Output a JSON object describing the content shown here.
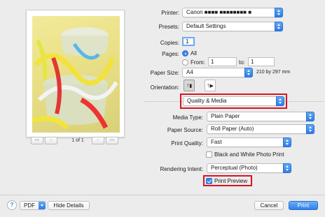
{
  "printer": {
    "label": "Printer:",
    "value": "Canon ■■■■ ■■■■■■■■ ■"
  },
  "presets": {
    "label": "Presets:",
    "value": "Default Settings"
  },
  "copies": {
    "label": "Copies:",
    "value": "1"
  },
  "pages": {
    "label": "Pages:",
    "all_label": "All",
    "from_label": "From:",
    "from_value": "1",
    "to_label": "to:",
    "to_value": "1",
    "selected": "All"
  },
  "paper_size": {
    "label": "Paper Size:",
    "value": "A4",
    "dimensions": "210 by 297 mm"
  },
  "orientation": {
    "label": "Orientation:",
    "portrait_glyph": "↑☺",
    "landscape_glyph": "↦"
  },
  "section_menu": {
    "value": "Quality & Media"
  },
  "media_type": {
    "label": "Media Type:",
    "value": "Plain Paper"
  },
  "paper_source": {
    "label": "Paper Source:",
    "value": "Roll Paper (Auto)"
  },
  "print_quality": {
    "label": "Print Quality:",
    "value": "Fast"
  },
  "bw_photo": {
    "label": "Black and White Photo Print",
    "checked": false
  },
  "rendering_intent": {
    "label": "Rendering Intent:",
    "value": "Perceptual (Photo)"
  },
  "print_preview": {
    "label": "Print Preview",
    "checked": true
  },
  "preview_nav": {
    "first": "««",
    "prev": "‹",
    "page_indicator": "1 of 1",
    "next": "›",
    "last": "»»"
  },
  "footer": {
    "help": "?",
    "pdf": "PDF",
    "hide_details": "Hide Details",
    "cancel": "Cancel",
    "print": "Print"
  },
  "colors": {
    "accent": "#3b87ee",
    "highlight": "#d8141e"
  }
}
